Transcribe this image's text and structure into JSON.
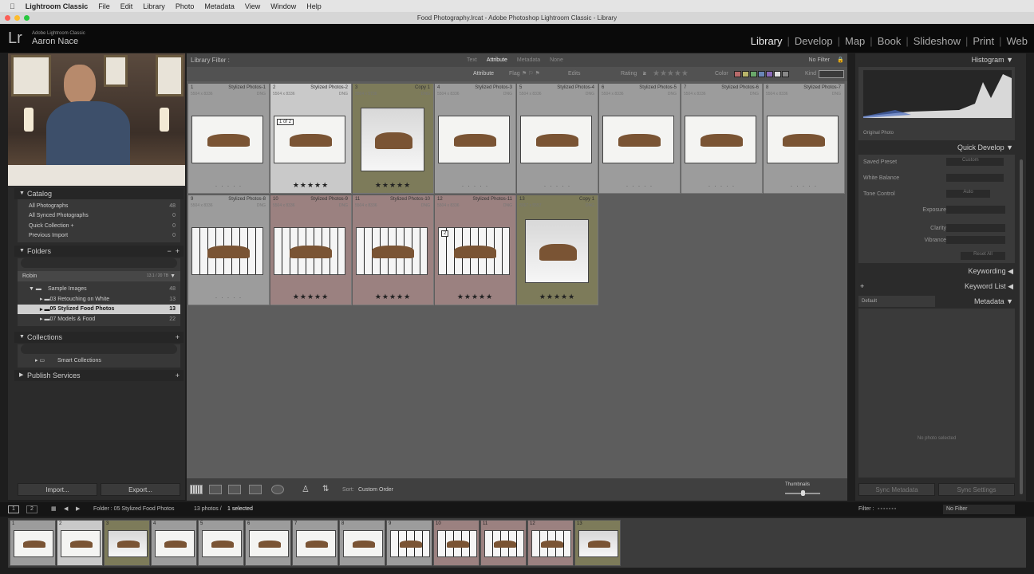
{
  "menubar": {
    "apple": "",
    "app": "Lightroom Classic",
    "items": [
      "File",
      "Edit",
      "Library",
      "Photo",
      "Metadata",
      "View",
      "Window",
      "Help"
    ]
  },
  "window_title": "Food Photography.lrcat - Adobe Photoshop Lightroom Classic - Library",
  "identity": {
    "logo": "Lr",
    "product": "Adobe Lightroom Classic",
    "user": "Aaron Nace"
  },
  "modules": [
    "Library",
    "Develop",
    "Map",
    "Book",
    "Slideshow",
    "Print",
    "Web"
  ],
  "active_module": "Library",
  "left": {
    "catalog": {
      "title": "Catalog",
      "items": [
        {
          "label": "All Photographs",
          "count": "48"
        },
        {
          "label": "All Synced Photographs",
          "count": "0"
        },
        {
          "label": "Quick Collection +",
          "count": "0"
        },
        {
          "label": "Previous Import",
          "count": "0"
        }
      ]
    },
    "folders": {
      "title": "Folders",
      "minus": "−",
      "plus": "+",
      "drive": "Robin",
      "drive_space": "13.1 / 20 TB",
      "root": {
        "label": "Sample Images",
        "count": "48"
      },
      "items": [
        {
          "label": "03 Retouching on White",
          "count": "13"
        },
        {
          "label": "05 Stylized Food Photos",
          "count": "13",
          "selected": true
        },
        {
          "label": "07 Models & Food",
          "count": "22"
        }
      ]
    },
    "collections": {
      "title": "Collections",
      "plus": "+",
      "items": [
        {
          "label": "Smart Collections"
        }
      ]
    },
    "publish": {
      "title": "Publish Services",
      "plus": "+"
    },
    "import": "Import...",
    "export": "Export..."
  },
  "filter": {
    "label": "Library Filter :",
    "tabs": [
      "Text",
      "Attribute",
      "Metadata",
      "None"
    ],
    "active": "Attribute",
    "preset": "No Filter",
    "attribute_label": "Attribute",
    "flag": "Flag",
    "edits": "Edits",
    "rating": "Rating",
    "rating_op": "≥",
    "color": "Color",
    "kind": "Kind",
    "color_swatches": [
      "#b86a6a",
      "#b8b46a",
      "#6aa86a",
      "#6a86b8",
      "#8a6ab8",
      "#dddddd",
      "#888888"
    ]
  },
  "grid": [
    {
      "idx": "1",
      "name": "Stylized Photos-1",
      "dim": "5504 x 8336",
      "ext": "DNG",
      "state": "normal",
      "rating": 0
    },
    {
      "idx": "2",
      "name": "Stylized Photos-2",
      "dim": "5504 x 8336",
      "ext": "DNG",
      "state": "selected",
      "rating": 5,
      "badge": "1 of 2"
    },
    {
      "idx": "3",
      "name": "Copy 1",
      "dim": "5504 x 5736",
      "ext": "DNG",
      "state": "olive",
      "rating": 5
    },
    {
      "idx": "4",
      "name": "Stylized Photos-3",
      "dim": "5504 x 8336",
      "ext": "DNG",
      "state": "normal",
      "rating": 0
    },
    {
      "idx": "5",
      "name": "Stylized Photos-4",
      "dim": "5504 x 8336",
      "ext": "DNG",
      "state": "normal",
      "rating": 0
    },
    {
      "idx": "6",
      "name": "Stylized Photos-5",
      "dim": "5504 x 8336",
      "ext": "DNG",
      "state": "normal",
      "rating": 0
    },
    {
      "idx": "7",
      "name": "Stylized Photos-6",
      "dim": "5504 x 8336",
      "ext": "DNG",
      "state": "normal",
      "rating": 0
    },
    {
      "idx": "8",
      "name": "Stylized Photos-7",
      "dim": "5504 x 8336",
      "ext": "DNG",
      "state": "normal",
      "rating": 0
    },
    {
      "idx": "9",
      "name": "Stylized Photos-8",
      "dim": "5504 x 8336",
      "ext": "DNG",
      "state": "normal",
      "rating": 0
    },
    {
      "idx": "10",
      "name": "Stylized Photos-9",
      "dim": "5504 x 8336",
      "ext": "DNG",
      "state": "pink",
      "rating": 5
    },
    {
      "idx": "11",
      "name": "Stylized Photos-10",
      "dim": "5504 x 8336",
      "ext": "DNG",
      "state": "pink",
      "rating": 5
    },
    {
      "idx": "12",
      "name": "Stylized Photos-11",
      "dim": "5504 x 8336",
      "ext": "DNG",
      "state": "pink",
      "rating": 5,
      "badge": "2"
    },
    {
      "idx": "13",
      "name": "Copy 1",
      "dim": "8367 x 5557",
      "ext": "DNG",
      "state": "olive",
      "rating": 5
    }
  ],
  "toolbar": {
    "sort_label": "Sort:",
    "sort_value": "Custom Order",
    "thumbnails": "Thumbnails"
  },
  "right": {
    "histogram": "Histogram",
    "original_photo": "Original Photo",
    "quick_develop": "Quick Develop",
    "saved_preset": "Saved Preset",
    "saved_preset_value": "Custom",
    "white_balance": "White Balance",
    "tone_control": "Tone Control",
    "auto": "Auto",
    "exposure": "Exposure",
    "clarity": "Clarity",
    "vibrance": "Vibrance",
    "reset_all": "Reset All",
    "keywording": "Keywording",
    "keyword_list": "Keyword List",
    "metadata": "Metadata",
    "metadata_preset": "Default",
    "no_photo": "No photo selected",
    "sync_metadata": "Sync Metadata",
    "sync_settings": "Sync Settings"
  },
  "filmstrip": {
    "view1": "1",
    "view2": "2",
    "path": "Folder : 05 Stylized Food Photos",
    "count": "13 photos /",
    "selected": "1 selected",
    "filter_label": "Filter :",
    "filter_value": "No Filter"
  },
  "watermark": "www.rrcg.cn"
}
